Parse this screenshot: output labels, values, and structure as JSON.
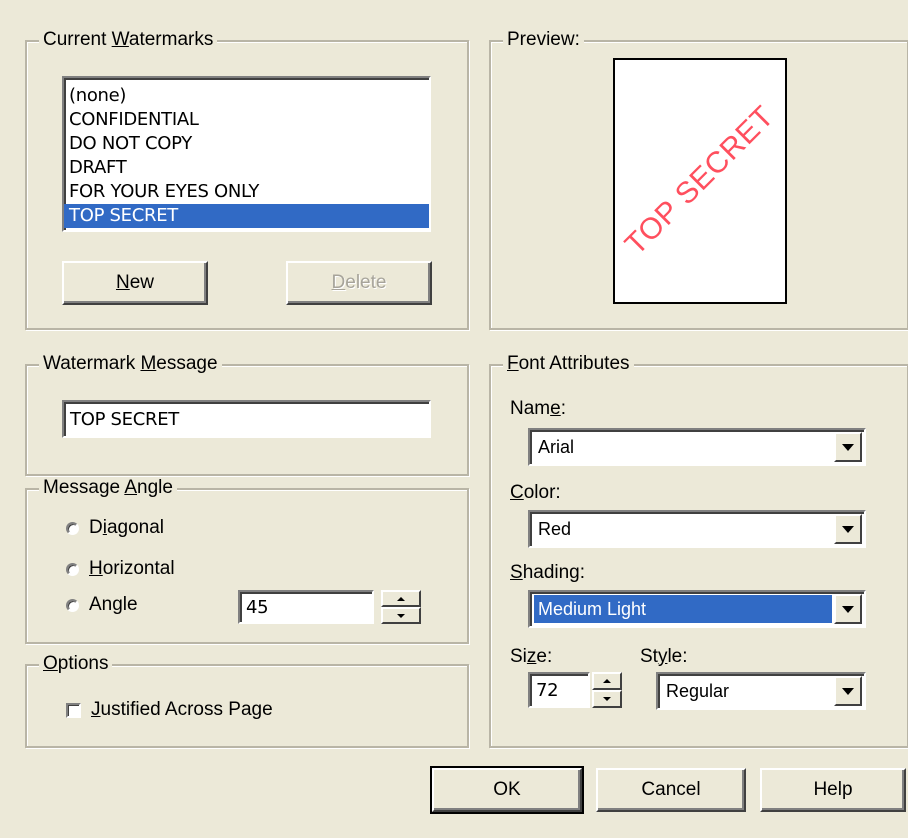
{
  "current_watermarks": {
    "title_pre": "Current ",
    "title_key": "W",
    "title_post": "atermarks",
    "items": [
      "(none)",
      "CONFIDENTIAL",
      "DO NOT COPY",
      "DRAFT",
      "FOR YOUR EYES ONLY",
      "TOP SECRET"
    ],
    "selected_index": 5,
    "new_key": "N",
    "new_post": "ew",
    "delete_key": "D",
    "delete_post": "elete"
  },
  "preview": {
    "title": "Preview:",
    "watermark_text": "TOP SECRET",
    "watermark_color": "#ff4f5e"
  },
  "watermark_message": {
    "title_pre": "Watermark ",
    "title_key": "M",
    "title_post": "essage",
    "value": "TOP SECRET"
  },
  "message_angle": {
    "title_pre": "Message ",
    "title_key": "A",
    "title_post": "ngle",
    "diagonal_pre": "D",
    "diagonal_key": "i",
    "diagonal_post": "agonal",
    "horizontal_key": "H",
    "horizontal_post": "orizontal",
    "angle_label": "Angle",
    "angle_value": "45"
  },
  "options": {
    "title_key": "O",
    "title_post": "ptions",
    "justified_key": "J",
    "justified_post": "ustified Across Page",
    "justified_checked": false
  },
  "font_attributes": {
    "title_key": "F",
    "title_post": "ont Attributes",
    "name_pre": "Nam",
    "name_key": "e",
    "name_post": ":",
    "name_value": "Arial",
    "color_key": "C",
    "color_post": "olor:",
    "color_value": "Red",
    "shading_key": "S",
    "shading_post": "hading:",
    "shading_value": "Medium Light",
    "size_pre": "Si",
    "size_key": "z",
    "size_post": "e:",
    "size_value": "72",
    "style_pre": "St",
    "style_key": "y",
    "style_post": "le:",
    "style_value": "Regular"
  },
  "buttons": {
    "ok": "OK",
    "cancel": "Cancel",
    "help": "Help"
  },
  "colors": {
    "dialog_bg": "#ece9d8",
    "selection": "#316ac5"
  }
}
